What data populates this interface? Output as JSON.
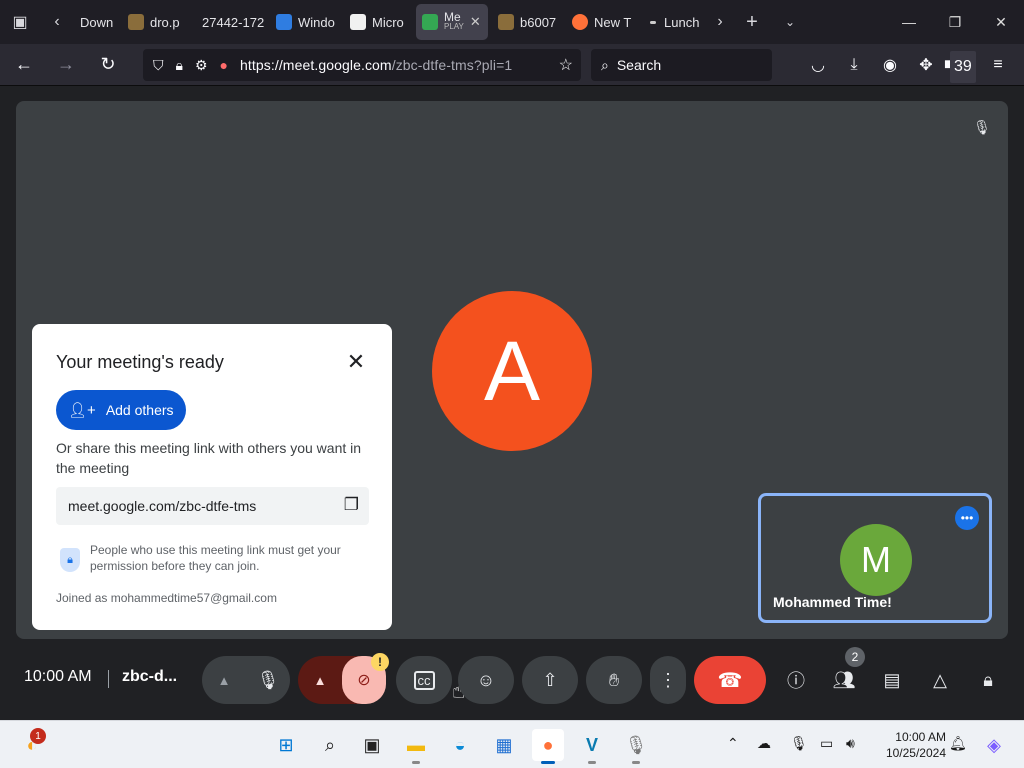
{
  "browser": {
    "tabs": [
      {
        "label": "Down",
        "color": "#3a7bd5"
      },
      {
        "label": "dro.p",
        "color": "#8a6d3b"
      },
      {
        "label": "27442-172",
        "color": "#6b6b6b"
      },
      {
        "label": "Windo",
        "color": "#2f7de1"
      },
      {
        "label": "Micro",
        "color": "#f1f1f1"
      },
      {
        "label": "Me",
        "sublabel": "PLAY",
        "color": "#34a853",
        "active": true
      },
      {
        "label": "b6007",
        "color": "#8a6d3b"
      },
      {
        "label": "New T",
        "color": "#ff7139"
      },
      {
        "label": "Lunch",
        "color": "#cccccc"
      }
    ],
    "url_host": "https://meet.google.com",
    "url_path": "/zbc-dtfe-tms?pli=1",
    "search_placeholder": "Search",
    "extension_badge": "39"
  },
  "dialog": {
    "title": "Your meeting's ready",
    "add_others": "Add others",
    "share_text": "Or share this meeting link with others you want in the meeting",
    "link": "meet.google.com/zbc-dtfe-tms",
    "permission_note": "People who use this meeting link must get your permission before they can join.",
    "joined_as": "Joined as mohammedtime57@gmail.com"
  },
  "participants": {
    "main_initial": "A",
    "self_initial": "M",
    "self_name": "Mohammed Time!",
    "main_color": "#f4511e",
    "self_color": "#6aa83b"
  },
  "controls": {
    "time": "10:00 AM",
    "meeting_code": "zbc-d...",
    "people_count": "2",
    "camera_warning": "!"
  },
  "taskbar": {
    "notification_count": "1",
    "clock_time": "10:00 AM",
    "clock_date": "10/25/2024"
  }
}
